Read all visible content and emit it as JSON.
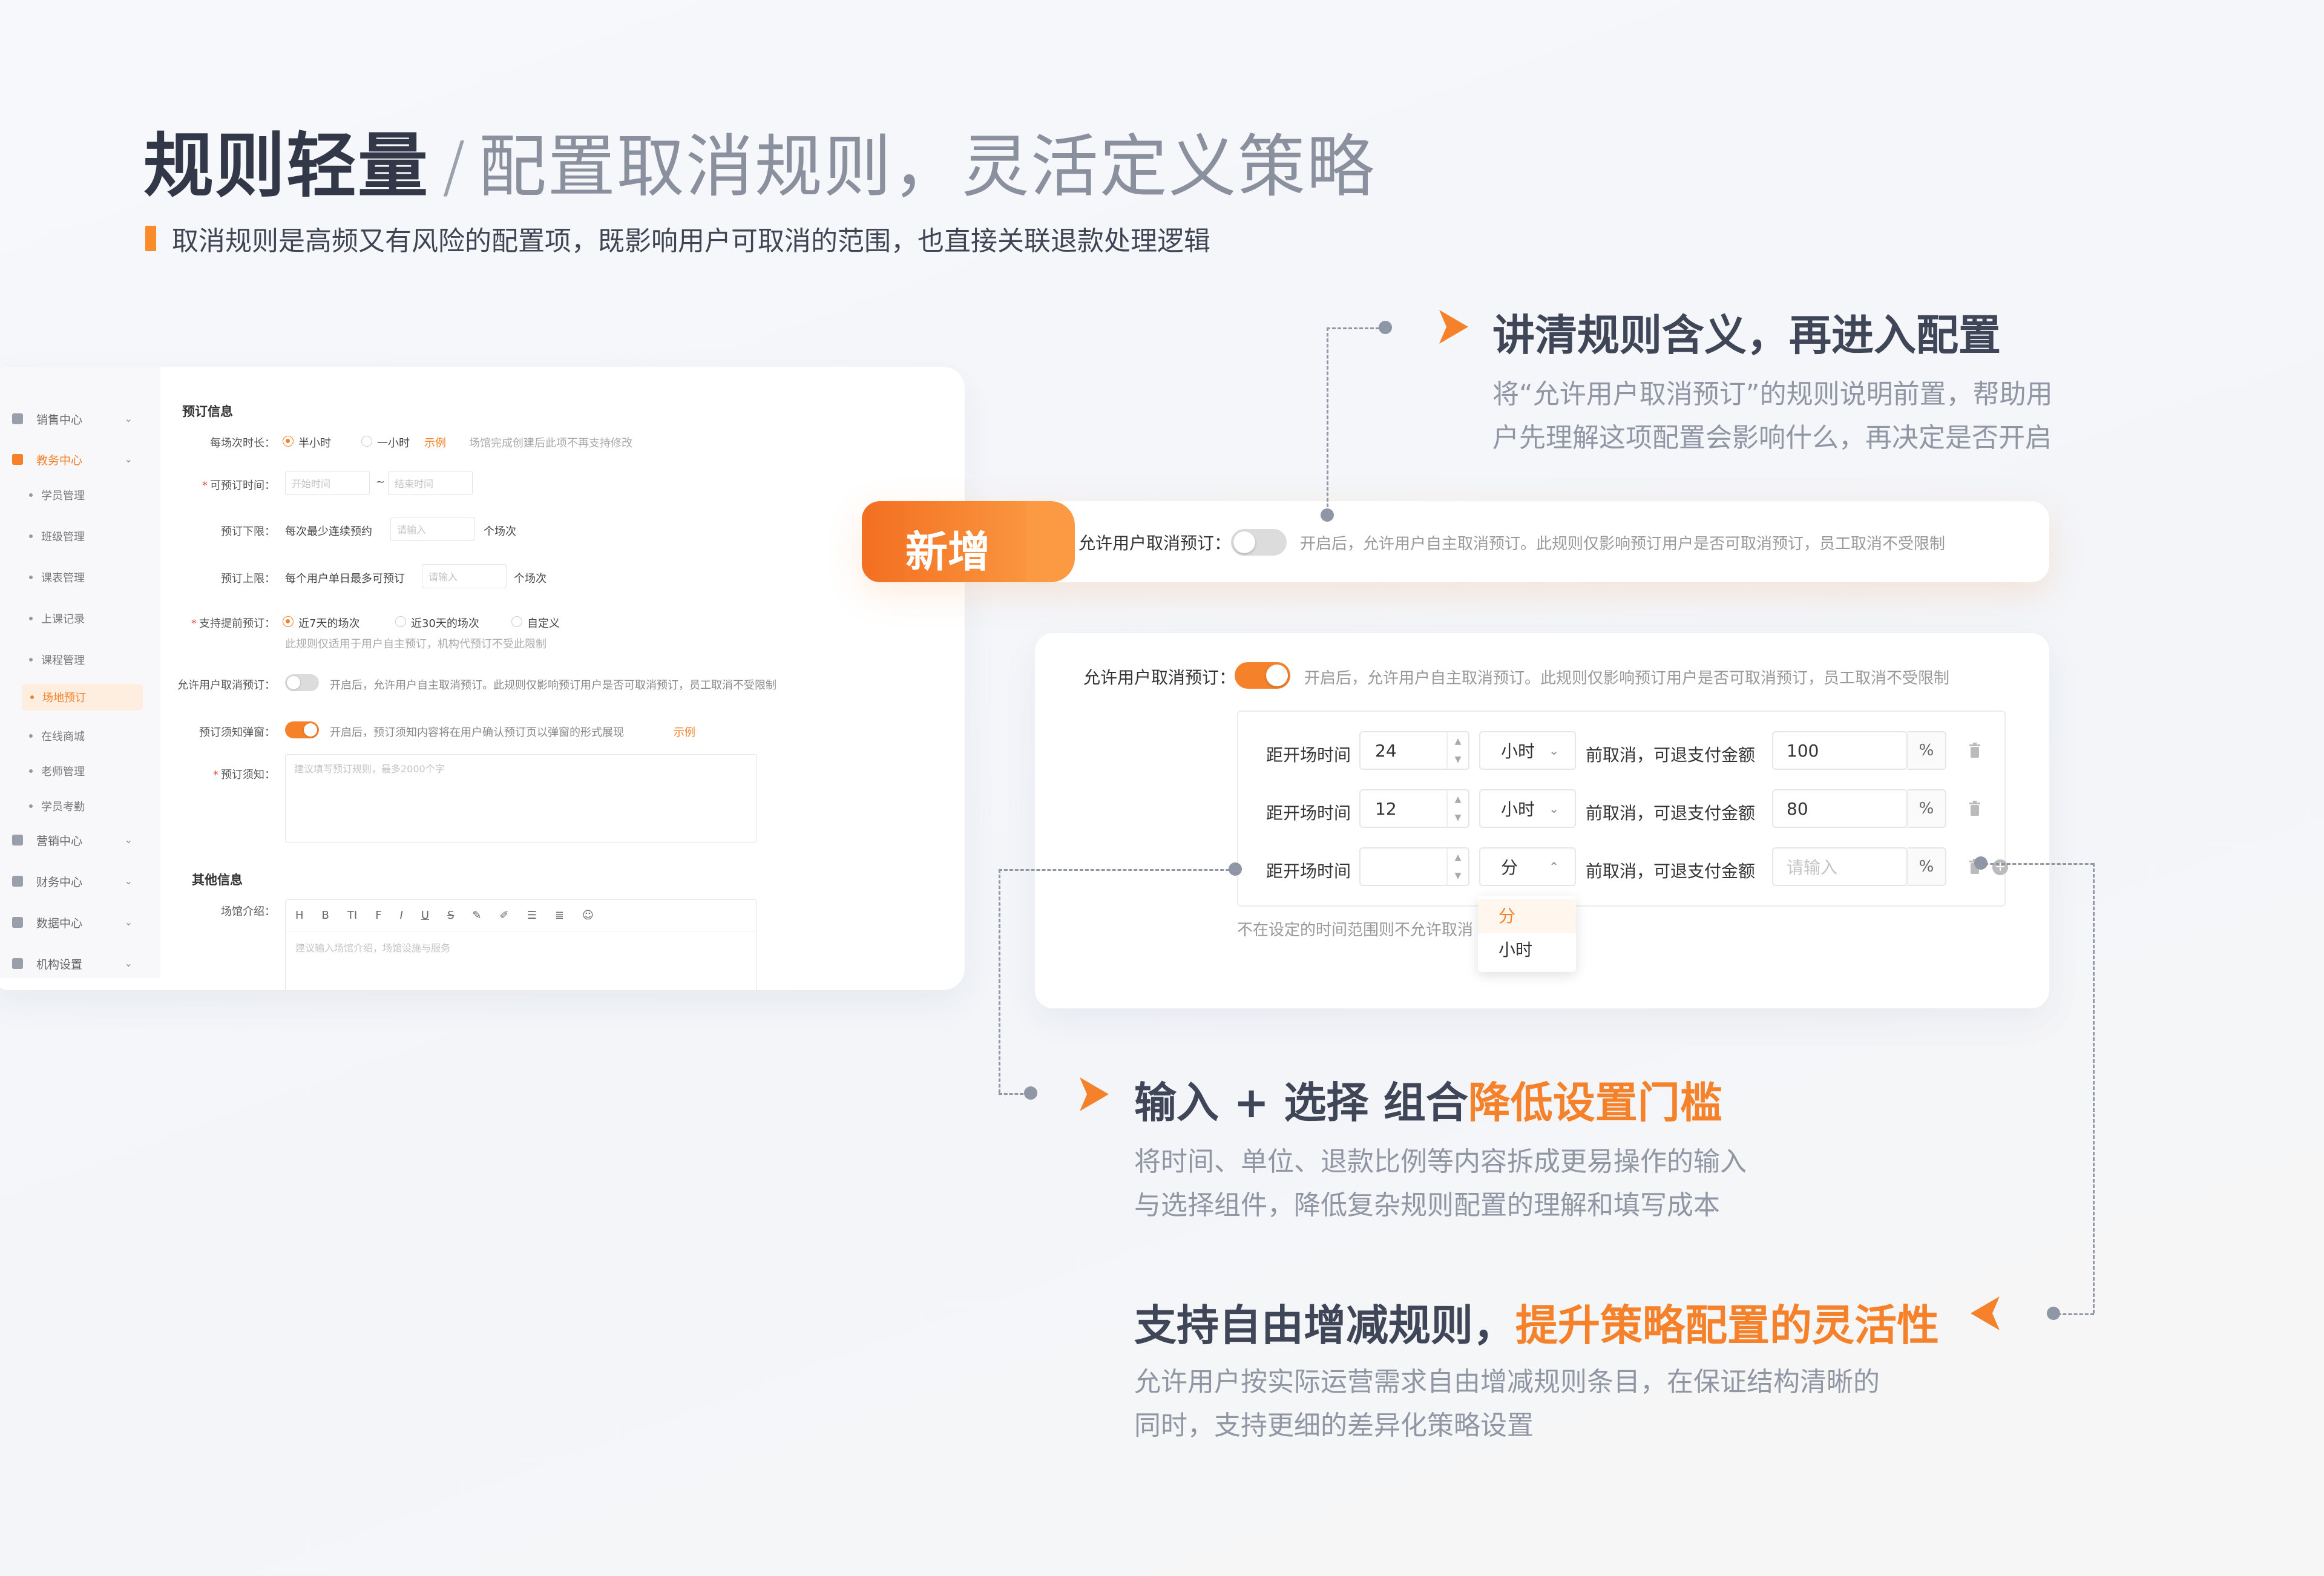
{
  "headline": {
    "bold": "规则轻量",
    "slash": "/",
    "light": "配置取消规则，灵活定义策略",
    "subtitle": "取消规则是高频又有风险的配置项，既影响用户可取消的范围，也直接关联退款处理逻辑"
  },
  "sidebar": {
    "items": [
      {
        "label": "销售中心",
        "icon": "user-icon"
      },
      {
        "label": "教务中心",
        "icon": "briefcase-icon",
        "active": true
      },
      {
        "label": "营销中心",
        "icon": "coin-icon"
      },
      {
        "label": "财务中心",
        "icon": "wallet-icon"
      },
      {
        "label": "数据中心",
        "icon": "chart-icon"
      },
      {
        "label": "机构设置",
        "icon": "building-icon"
      }
    ],
    "sub_items": [
      "学员管理",
      "班级管理",
      "课表管理",
      "上课记录",
      "课程管理",
      "场地预订",
      "在线商城",
      "老师管理",
      "学员考勤"
    ],
    "active_sub": "场地预订"
  },
  "form": {
    "section_booking": "预订信息",
    "duration_label": "每场次时长：",
    "duration_opt1": "半小时",
    "duration_opt2": "一小时",
    "duration_example": "示例",
    "duration_hint": "场馆完成创建后此项不再支持修改",
    "time_label": "可预订时间：",
    "time_start_ph": "开始时间",
    "time_sep": "~",
    "time_end_ph": "结束时间",
    "min_label": "预订下限：",
    "min_text": "每次最少连续预约",
    "min_ph": "请输入",
    "min_unit": "个场次",
    "max_label": "预订上限：",
    "max_text": "每个用户单日最多可预订",
    "max_ph": "请输入",
    "max_unit": "个场次",
    "advance_label": "支持提前预订：",
    "advance_opt1": "近7天的场次",
    "advance_opt2": "近30天的场次",
    "advance_opt3": "自定义",
    "advance_hint": "此规则仅适用于用户自主预订，机构代预订不受此限制",
    "cancel_label": "允许用户取消预订：",
    "cancel_desc": "开启后，允许用户自主取消预订。此规则仅影响预订用户是否可取消预订，员工取消不受限制",
    "popup_label": "预订须知弹窗：",
    "popup_desc": "开启后，预订须知内容将在用户确认预订页以弹窗的形式展现",
    "popup_example": "示例",
    "notice_label": "预订须知：",
    "notice_ph": "建议填写预订规则，最多2000个字",
    "section_other": "其他信息",
    "intro_label": "场馆介绍：",
    "intro_ph": "建议输入场馆介绍，场馆设施与服务",
    "rte_tools": [
      "H",
      "B",
      "TI",
      "F",
      "I",
      "U",
      "S",
      "✎",
      "✐",
      "☰",
      "≣",
      "☺"
    ]
  },
  "banner": {
    "tag": "新增",
    "label": "允许用户取消预订：",
    "desc": "开启后，允许用户自主取消预订。此规则仅影响预订用户是否可取消预订，员工取消不受限制"
  },
  "rule_card": {
    "label": "允许用户取消预订：",
    "desc": "开启后，允许用户自主取消预订。此规则仅影响预订用户是否可取消预订，员工取消不受限制",
    "rows": [
      {
        "prefix": "距开场时间",
        "value": "24",
        "unit": "小时",
        "chev": "⌄",
        "mid": "前取消，可退支付金额",
        "amount": "100",
        "amount_ph": "",
        "pct": "%"
      },
      {
        "prefix": "距开场时间",
        "value": "12",
        "unit": "小时",
        "chev": "⌄",
        "mid": "前取消，可退支付金额",
        "amount": "80",
        "amount_ph": "",
        "pct": "%"
      },
      {
        "prefix": "距开场时间",
        "value": "",
        "unit": "分",
        "chev": "⌃",
        "mid": "前取消，可退支付金额",
        "amount": "",
        "amount_ph": "请输入",
        "pct": "%"
      }
    ],
    "note": "不在设定的时间范围则不允许取消",
    "dropdown": [
      "分",
      "小时"
    ]
  },
  "callouts": {
    "c1_title": "讲清规则含义，再进入配置",
    "c1_body1": "将“允许用户取消预订”的规则说明前置，帮助用",
    "c1_body2": "户先理解这项配置会影响什么，再决定是否开启",
    "c2_title_a": "输入 + 选择 组合",
    "c2_title_b": "降低设置门槛",
    "c2_body1": "将时间、单位、退款比例等内容拆成更易操作的输入",
    "c2_body2": "与选择组件，降低复杂规则配置的理解和填写成本",
    "c3_title_a": "支持自由增减规则，",
    "c3_title_b": "提升策略配置的灵活性",
    "c3_body1": "允许用户按实际运营需求自由增减规则条目，在保证结构清晰的",
    "c3_body2": "同时，支持更细的差异化策略设置"
  },
  "colors": {
    "accent": "#f5822a",
    "title": "#323848",
    "muted": "#9096a3"
  }
}
